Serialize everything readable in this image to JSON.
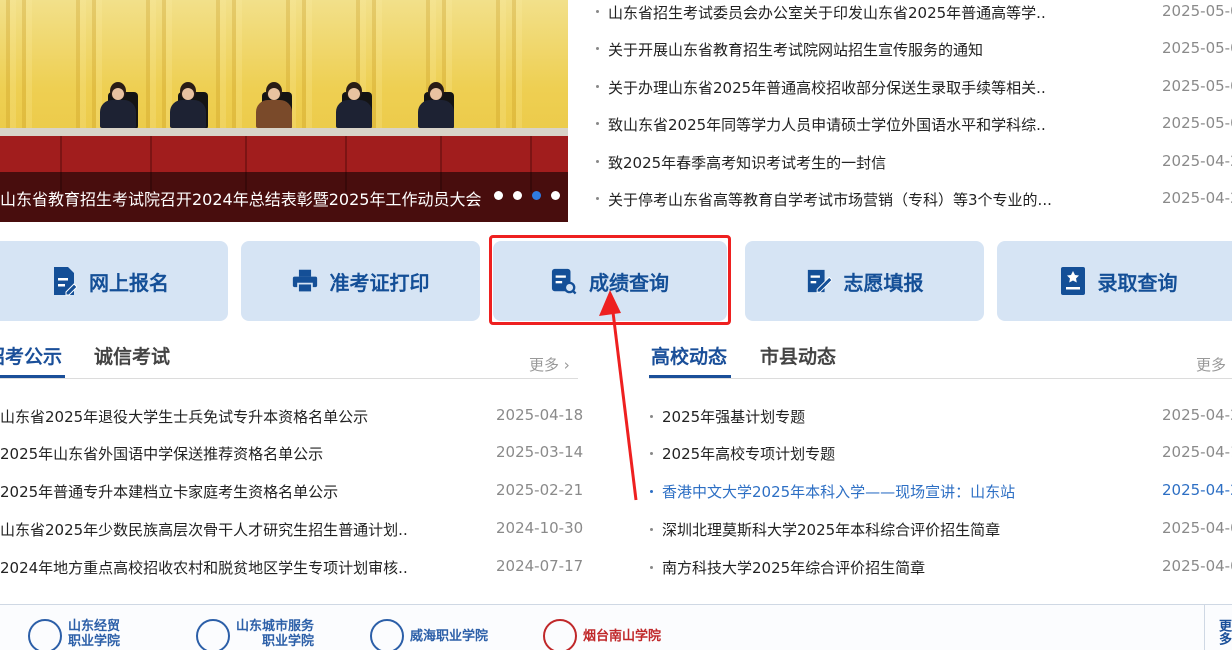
{
  "banner": {
    "caption": "山东省教育招生考试院召开2024年总结表彰暨2025年工作动员大会",
    "slide_count": 4,
    "active_slide": 3
  },
  "top_news": [
    {
      "title": "山东省招生考试委员会办公室关于印发山东省2025年普通高等学..",
      "date": "2025-05-0"
    },
    {
      "title": "关于开展山东省教育招生考试院网站招生宣传服务的通知",
      "date": "2025-05-0"
    },
    {
      "title": "关于办理山东省2025年普通高校招收部分保送生录取手续等相关..",
      "date": "2025-05-0"
    },
    {
      "title": "致山东省2025年同等学力人员申请硕士学位外国语水平和学科综..",
      "date": "2025-05-0"
    },
    {
      "title": "致2025年春季高考知识考试考生的一封信",
      "date": "2025-04-2"
    },
    {
      "title": "关于停考山东省高等教育自学考试市场营销（专科）等3个专业的...",
      "date": "2025-04-2"
    }
  ],
  "quick_links": [
    {
      "label": "网上报名",
      "icon": "document-edit-icon"
    },
    {
      "label": "准考证打印",
      "icon": "printer-icon"
    },
    {
      "label": "成绩查询",
      "icon": "score-search-icon"
    },
    {
      "label": "志愿填报",
      "icon": "form-pen-icon"
    },
    {
      "label": "录取查询",
      "icon": "certificate-icon"
    }
  ],
  "left_section": {
    "tabs": [
      "招考公示",
      "诚信考试"
    ],
    "more": "更多",
    "items": [
      {
        "title": "山东省2025年退役大学生士兵免试专升本资格名单公示",
        "date": "2025-04-18"
      },
      {
        "title": "2025年山东省外国语中学保送推荐资格名单公示",
        "date": "2025-03-14"
      },
      {
        "title": "2025年普通专升本建档立卡家庭考生资格名单公示",
        "date": "2025-02-21"
      },
      {
        "title": "山东省2025年少数民族高层次骨干人才研究生招生普通计划..",
        "date": "2024-10-30"
      },
      {
        "title": "2024年地方重点高校招收农村和脱贫地区学生专项计划审核..",
        "date": "2024-07-17"
      }
    ]
  },
  "right_section": {
    "tabs": [
      "高校动态",
      "市县动态"
    ],
    "more": "更多",
    "items": [
      {
        "title": "2025年强基计划专题",
        "date": "2025-04-2"
      },
      {
        "title": "2025年高校专项计划专题",
        "date": "2025-04-1"
      },
      {
        "title": "香港中文大学2025年本科入学——现场宣讲：山东站",
        "date": "2025-04-2",
        "highlight": true
      },
      {
        "title": "深圳北理莫斯科大学2025年本科综合评价招生简章",
        "date": "2025-04-0"
      },
      {
        "title": "南方科技大学2025年综合评价招生简章",
        "date": "2025-04-0"
      }
    ]
  },
  "footer": {
    "logos": [
      {
        "line1": "山东经贸",
        "line2": "职业学院"
      },
      {
        "line1": "山东城市服务",
        "line2": "职业学院"
      },
      {
        "line1": "威海职业学院",
        "line2": ""
      },
      {
        "line1": "烟台南山学院",
        "line2": ""
      }
    ],
    "more": "更多"
  },
  "colors": {
    "accent": "#1a4f99",
    "button_bg": "#d6e4f4",
    "highlight_border": "#ee2020",
    "link": "#2d6fc4"
  }
}
